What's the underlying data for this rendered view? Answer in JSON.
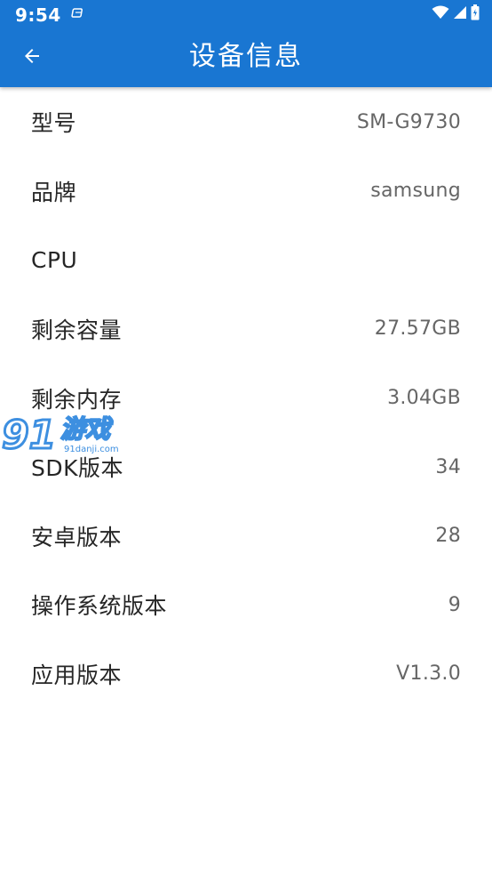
{
  "status_bar": {
    "time": "9:54"
  },
  "toolbar": {
    "title": "设备信息"
  },
  "device_info": [
    {
      "label": "型号",
      "value": "SM-G9730"
    },
    {
      "label": "品牌",
      "value": "samsung"
    },
    {
      "label": "CPU",
      "value": ""
    },
    {
      "label": "剩余容量",
      "value": "27.57GB"
    },
    {
      "label": "剩余内存",
      "value": "3.04GB"
    },
    {
      "label": "SDK版本",
      "value": "34"
    },
    {
      "label": "安卓版本",
      "value": "28"
    },
    {
      "label": "操作系统版本",
      "value": "9"
    },
    {
      "label": "应用版本",
      "value": "V1.3.0"
    }
  ],
  "watermark": {
    "number": "91",
    "text": "游戏",
    "domain": "91danji.com"
  },
  "colors": {
    "app_bar": "#1976d2",
    "label_text": "#262626",
    "value_text": "#666666"
  },
  "icons": {
    "back": "arrow-left-icon",
    "notification": "notification-icon",
    "wifi": "wifi-icon",
    "cell": "cellular-signal-icon",
    "battery": "battery-icon"
  }
}
